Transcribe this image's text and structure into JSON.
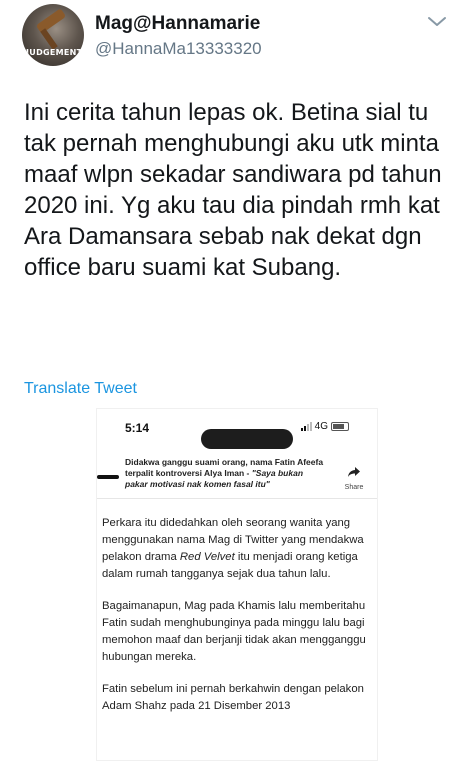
{
  "user": {
    "display_name": "Mag@Hannamarie",
    "handle": "@HannaMa13333320",
    "avatar_stamp": "JUDGEMENT"
  },
  "tweet": {
    "text": "Ini cerita tahun lepas ok. Betina sial tu tak pernah menghubungi aku utk minta maaf wlpn sekadar sandiwara pd tahun 2020 ini. Yg aku tau dia pindah rmh kat Ara Damansara sebab nak dekat dgn office baru suami kat Subang.",
    "translate_label": "Translate Tweet"
  },
  "embed": {
    "status_time": "5:14",
    "network": "4G",
    "headline_part1": "Didakwa ganggu suami orang, nama Fatin Afeefa terpalit kontroversi Alya Iman - ",
    "headline_part2": "\"Saya bukan pakar motivasi nak komen fasal itu\"",
    "share_label": "Share",
    "para1_a": "Perkara itu didedahkan oleh seorang wanita yang menggunakan nama Mag di Twitter yang mendakwa pelakon drama ",
    "para1_italic": "Red Velvet",
    "para1_b": " itu menjadi orang ketiga dalam rumah tangganya sejak dua tahun lalu.",
    "para2": "Bagaimanapun, Mag pada Khamis lalu memberitahu Fatin sudah menghubunginya pada minggu lalu bagi memohon maaf dan berjanji tidak akan mengganggu hubungan mereka.",
    "para3": "Fatin sebelum ini pernah berkahwin dengan pelakon Adam Shahz pada 21 Disember 2013"
  }
}
